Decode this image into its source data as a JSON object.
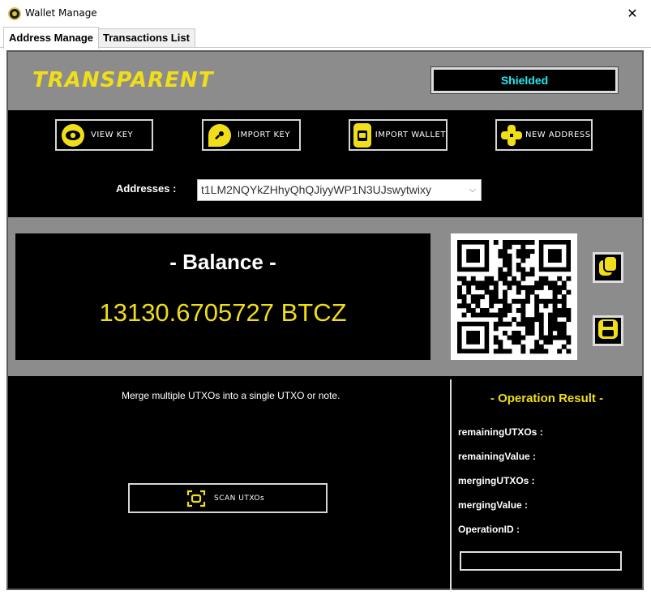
{
  "window": {
    "title": "Wallet Manage",
    "close_glyph": "✕"
  },
  "tabs": [
    {
      "label": "Address Manage",
      "active": true
    },
    {
      "label": "Transactions List",
      "active": false
    }
  ],
  "header": {
    "brand": "TRANSPARENT",
    "shielded_button": "Shielded"
  },
  "toolbar": {
    "view_key": "VIEW KEY",
    "import_key": "IMPORT KEY",
    "import_wallet": "IMPORT WALLET",
    "new_address": "NEW ADDRESS"
  },
  "addresses": {
    "label": "Addresses :",
    "selected": "t1LM2NQYkZHhyQhQJiyyWP1N3UJswytwixy"
  },
  "balance": {
    "title": "- Balance -",
    "value": "13130.6705727  BTCZ"
  },
  "merge": {
    "description": "Merge multiple UTXOs into a single UTXO or note.",
    "scan_button": "SCAN UTXOs"
  },
  "result": {
    "title": "- Operation Result -",
    "labels": [
      "remainingUTXOs :",
      "remainingValue :",
      "mergingUTXOs :",
      "mergingValue :",
      "OperationID :"
    ]
  },
  "icons": {
    "view_key": "eye-icon",
    "import_key": "key-icon",
    "import_wallet": "wallet-import-icon",
    "new_address": "plus-icon",
    "copy": "copy-icon",
    "save": "save-icon",
    "scan": "scan-icon"
  },
  "colors": {
    "accent": "#f0de1a",
    "shielded_text": "#24e8f0",
    "band": "#8c8c8c"
  }
}
